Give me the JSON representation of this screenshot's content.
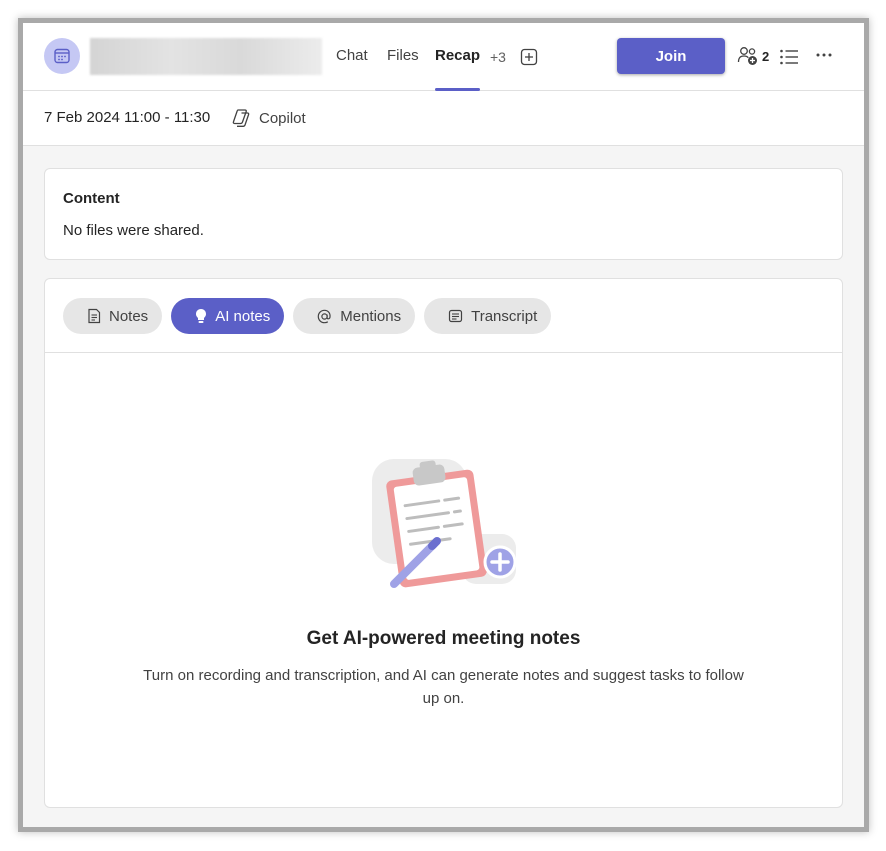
{
  "header": {
    "tabs": [
      {
        "label": "Chat"
      },
      {
        "label": "Files"
      },
      {
        "label": "Recap",
        "active": true
      }
    ],
    "more_tabs_count": "+3",
    "join_label": "Join",
    "participant_count": "2"
  },
  "subheader": {
    "date_time": "7 Feb 2024 11:00 - 11:30",
    "copilot_label": "Copilot"
  },
  "content_card": {
    "title": "Content",
    "body": "No files were shared."
  },
  "notes_tabs": [
    {
      "label": "Notes",
      "icon": "notes-icon"
    },
    {
      "label": "AI notes",
      "icon": "lightbulb-icon",
      "active": true
    },
    {
      "label": "Mentions",
      "icon": "at-icon"
    },
    {
      "label": "Transcript",
      "icon": "transcript-icon"
    }
  ],
  "empty_state": {
    "title": "Get AI-powered meeting notes",
    "body": "Turn on recording and transcription, and AI can generate notes and suggest tasks to follow up on."
  },
  "colors": {
    "accent": "#5b5fc7",
    "avatar_bg": "#c5c8f4"
  }
}
